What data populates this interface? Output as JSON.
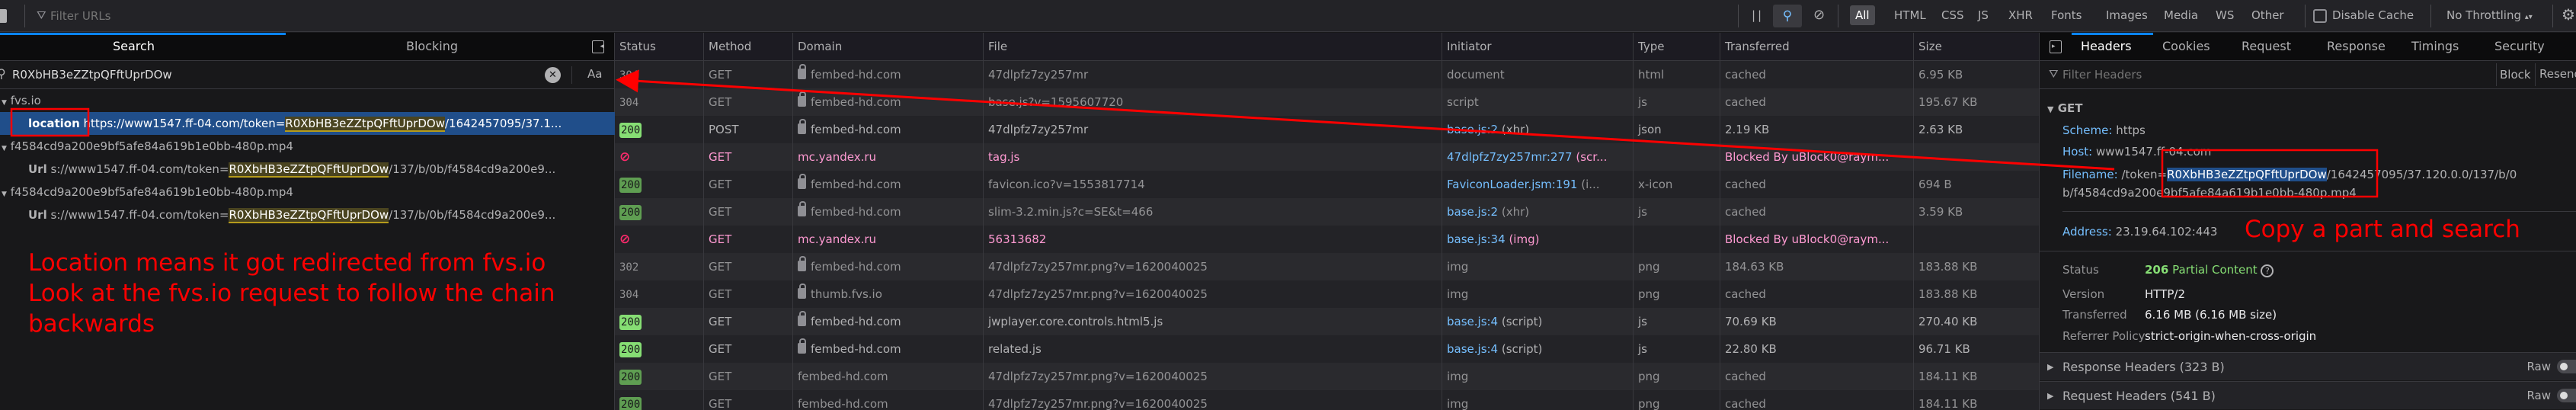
{
  "toolbar": {
    "filter_placeholder": "Filter URLs",
    "type_filters": [
      "All",
      "HTML",
      "CSS",
      "JS",
      "XHR",
      "Fonts",
      "Images",
      "Media",
      "WS",
      "Other"
    ],
    "active_filter": "All",
    "disable_cache_label": "Disable Cache",
    "throttling_value": "No Throttling"
  },
  "left_panel": {
    "tabs": [
      "Search",
      "Blocking"
    ],
    "active_tab": "Search",
    "search_value": "R0XbHB3eZZtpQFftUprDOw",
    "case_toggle": "Aa",
    "results": [
      {
        "kind": "group",
        "text": "fvs.io"
      },
      {
        "kind": "match",
        "key": "location",
        "prefix": "https://www1547.ff-04.com/token=",
        "match": "R0XbHB3eZZtpQFftUprDOw",
        "suffix": "/1642457095/37.1...",
        "selected": true
      },
      {
        "kind": "group",
        "text": "f4584cd9a200e9bf5afe84a619b1e0bb-480p.mp4"
      },
      {
        "kind": "match",
        "key": "Url",
        "prefix": "s://www1547.ff-04.com/token=",
        "match": "R0XbHB3eZZtpQFftUprDOw",
        "suffix": "/137/b/0b/f4584cd9a200e9..."
      },
      {
        "kind": "group",
        "text": "f4584cd9a200e9bf5afe84a619b1e0bb-480p.mp4"
      },
      {
        "kind": "match",
        "key": "Url",
        "prefix": "s://www1547.ff-04.com/token=",
        "match": "R0XbHB3eZZtpQFftUprDOw",
        "suffix": "/137/b/0b/f4584cd9a200e9..."
      }
    ]
  },
  "annotations": {
    "left_note": [
      "Location means it got redirected from fvs.io",
      "Look at the fvs.io request to follow the chain",
      "backwards"
    ],
    "right_note": "Copy a part and search",
    "color": "#ff0000"
  },
  "table": {
    "columns": [
      "Status",
      "Method",
      "Domain",
      "File",
      "Initiator",
      "Type",
      "Transferred",
      "Size"
    ],
    "rows": [
      {
        "status": "304",
        "kind": "plain",
        "method": "GET",
        "lock": true,
        "domain": "fembed-hd.com",
        "file": "47dlpfz7zy257mr",
        "init_link": "",
        "init_note": "document",
        "type": "html",
        "transferred": "cached",
        "size": "6.95 KB"
      },
      {
        "status": "304",
        "kind": "plain",
        "method": "GET",
        "lock": true,
        "domain": "fembed-hd.com",
        "file": "base.js?v=1595607720",
        "init_link": "",
        "init_note": "script",
        "type": "js",
        "transferred": "cached",
        "size": "195.67 KB"
      },
      {
        "status": "200",
        "kind": "ok",
        "method": "POST",
        "lock": true,
        "domain": "fembed-hd.com",
        "file": "47dlpfz7zy257mr",
        "init_link": "base.js:2",
        "init_note": "(xhr)",
        "type": "json",
        "transferred": "2.19 KB",
        "size": "2.63 KB"
      },
      {
        "status": "",
        "kind": "blocked",
        "method": "GET",
        "lock": false,
        "domain": "mc.yandex.ru",
        "file": "tag.js",
        "init_link": "47dlpfz7zy257mr:277",
        "init_note": "(scr...",
        "type": "",
        "transferred": "Blocked By uBlock0@raym...",
        "size": ""
      },
      {
        "status": "200",
        "kind": "cached",
        "method": "GET",
        "lock": true,
        "domain": "fembed-hd.com",
        "file": "favicon.ico?v=1553817714",
        "init_link": "FaviconLoader.jsm:191",
        "init_note": "(i...",
        "type": "x-icon",
        "transferred": "cached",
        "size": "694 B"
      },
      {
        "status": "200",
        "kind": "cached",
        "method": "GET",
        "lock": true,
        "domain": "fembed-hd.com",
        "file": "slim-3.2.min.js?c=SE&t=466",
        "init_link": "base.js:2",
        "init_note": "(xhr)",
        "type": "js",
        "transferred": "cached",
        "size": "3.59 KB"
      },
      {
        "status": "",
        "kind": "blocked",
        "method": "GET",
        "lock": false,
        "domain": "mc.yandex.ru",
        "file": "56313682",
        "init_link": "base.js:34",
        "init_note": "(img)",
        "type": "",
        "transferred": "Blocked By uBlock0@raym...",
        "size": ""
      },
      {
        "status": "302",
        "kind": "plain",
        "method": "GET",
        "lock": true,
        "domain": "fembed-hd.com",
        "file": "47dlpfz7zy257mr.png?v=1620040025",
        "init_link": "",
        "init_note": "img",
        "type": "png",
        "transferred": "184.63 KB",
        "size": "183.88 KB"
      },
      {
        "status": "304",
        "kind": "plain",
        "method": "GET",
        "lock": true,
        "domain": "thumb.fvs.io",
        "file": "47dlpfz7zy257mr.png?v=1620040025",
        "init_link": "",
        "init_note": "img",
        "type": "png",
        "transferred": "cached",
        "size": "183.88 KB"
      },
      {
        "status": "200",
        "kind": "ok",
        "method": "GET",
        "lock": true,
        "domain": "fembed-hd.com",
        "file": "jwplayer.core.controls.html5.js",
        "init_link": "base.js:4",
        "init_note": "(script)",
        "type": "js",
        "transferred": "70.69 KB",
        "size": "270.40 KB"
      },
      {
        "status": "200",
        "kind": "ok",
        "method": "GET",
        "lock": true,
        "domain": "fembed-hd.com",
        "file": "related.js",
        "init_link": "base.js:4",
        "init_note": "(script)",
        "type": "js",
        "transferred": "22.80 KB",
        "size": "96.71 KB"
      },
      {
        "status": "200",
        "kind": "cached",
        "method": "GET",
        "lock": false,
        "domain": "fembed-hd.com",
        "file": "47dlpfz7zy257mr.png?v=1620040025",
        "init_link": "",
        "init_note": "img",
        "type": "png",
        "transferred": "cached",
        "size": "184.11 KB"
      },
      {
        "status": "200",
        "kind": "cached",
        "method": "GET",
        "lock": false,
        "domain": "fembed-hd.com",
        "file": "47dlpfz7zy257mr.png?v=1620040025",
        "init_link": "",
        "init_note": "img",
        "type": "png",
        "transferred": "cached",
        "size": "184.11 KB"
      }
    ]
  },
  "details": {
    "tabs": [
      "Headers",
      "Cookies",
      "Request",
      "Response",
      "Timings",
      "Security"
    ],
    "active_tab": "Headers",
    "filter_placeholder": "Filter Headers",
    "block_label": "Block",
    "resend_label": "Resend",
    "method": "GET",
    "scheme_label": "Scheme:",
    "scheme": "https",
    "host_label": "Host:",
    "host": "www1547.ff-04.com",
    "filename_label": "Filename:",
    "filename_prefix": "/token=",
    "filename_selected": "R0XbHB3eZZtpQFftUprDOw",
    "filename_rest": "/1642457095/37.120.0.0/137/b/0",
    "filename_line2": "b/f4584cd9a200e9bf5afe84a619b1e0bb-480p.mp4",
    "address_label": "Address:",
    "address": "23.19.64.102:443",
    "status_label": "Status",
    "status_code": "206",
    "status_text": "Partial Content",
    "version_label": "Version",
    "version": "HTTP/2",
    "transferred_label": "Transferred",
    "transferred": "6.16 MB (6.16 MB size)",
    "referrer_label": "Referrer Policy",
    "referrer": "strict-origin-when-cross-origin",
    "response_headers": "Response Headers (323 B)",
    "request_headers": "Request Headers (541 B)",
    "raw_label": "Raw"
  }
}
